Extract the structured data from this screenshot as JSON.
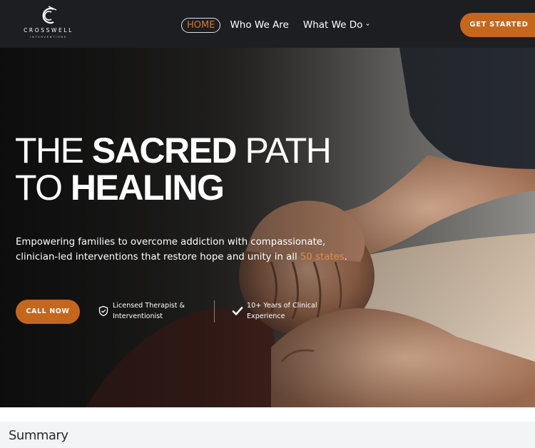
{
  "header": {
    "logo": {
      "name": "CROSSWELL",
      "sub": "INTERVENTIONS",
      "mark": "C"
    },
    "nav": [
      {
        "label": "HOME"
      },
      {
        "label": "Who We Are"
      },
      {
        "label": "What We Do",
        "has_dropdown": true
      }
    ],
    "cta_label": "GET STARTED"
  },
  "hero": {
    "title_line1_thin": "THE ",
    "title_line1_bold": "SACRED",
    "title_line1_thin2": " PATH",
    "title_line2_thin": "TO ",
    "title_line2_bold": "HEALING",
    "desc_part1": " Empowering families to overcome addiction with compassionate, clinician-led interventions that restore hope and unity in all ",
    "desc_highlight": "50 states",
    "desc_end": ".",
    "call_label": "CALL NOW",
    "badges": [
      {
        "icon": "shield-check-icon",
        "text": "Licensed Therapist & Interventionist"
      },
      {
        "icon": "checkmark-icon",
        "text": "10+ Years of Clinical Experience"
      }
    ]
  },
  "summary": {
    "title": "Summary"
  },
  "colors": {
    "accent": "#c4661c",
    "nav_active": "#d97a2c",
    "header_bg": "#1c1e22",
    "highlight": "#e28a45"
  }
}
